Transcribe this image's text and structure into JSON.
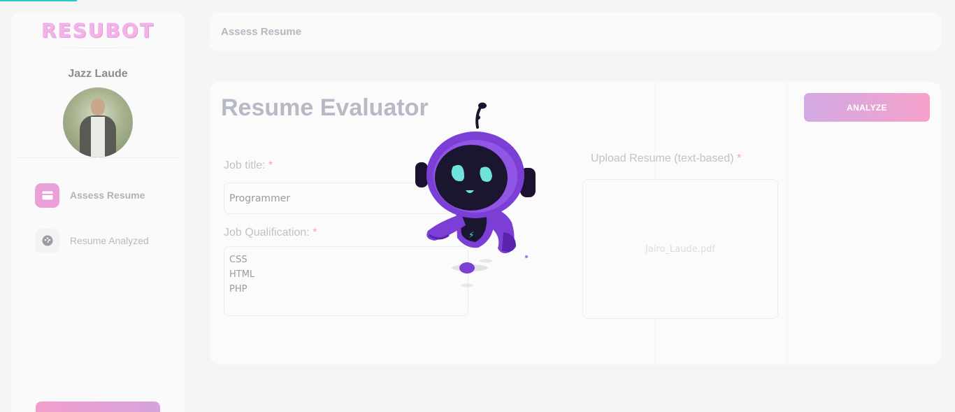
{
  "app": {
    "logo_text": "RESUBOT"
  },
  "sidebar": {
    "user_name": "Jazz Laude",
    "items": [
      {
        "label": "Assess Resume",
        "icon": "card-icon",
        "active": true
      },
      {
        "label": "Resume Analyzed",
        "icon": "gauge-icon",
        "active": false
      }
    ]
  },
  "header": {
    "title": "Assess Resume"
  },
  "evaluator": {
    "title": "Resume Evaluator",
    "analyze_label": "ANALYZE",
    "job_title_label": "Job title:",
    "job_title_value": "Programmer",
    "job_qualification_label": "Job Qualification:",
    "job_qualification_value": "CSS\nHTML\nPHP",
    "upload_label": "Upload Resume (text-based)",
    "uploaded_file": "Jairo_Laude.pdf",
    "required_mark": "*"
  },
  "colors": {
    "accent_pink": "#f5a2ca",
    "accent_purple": "#d3a8e4",
    "robot_purple": "#7b3fd6",
    "progress_teal": "#2bc8c8"
  }
}
